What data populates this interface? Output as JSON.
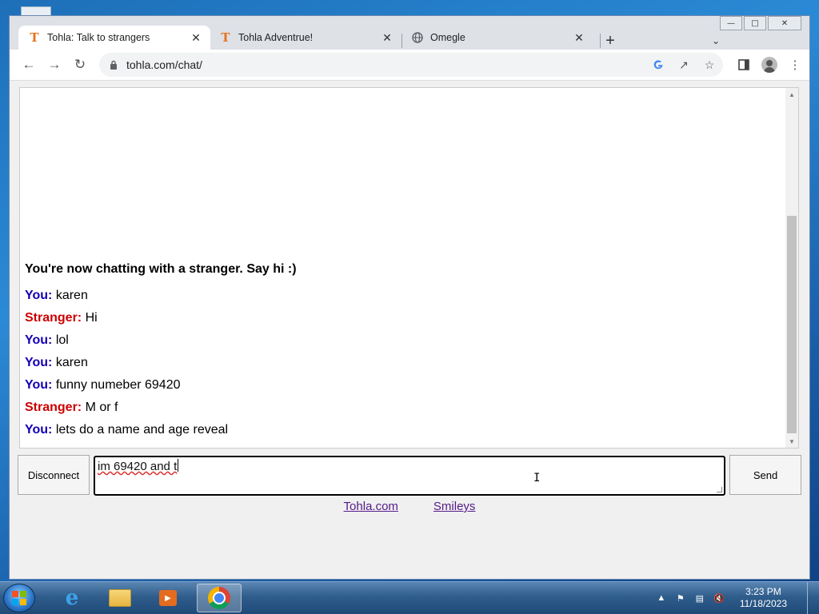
{
  "browser": {
    "tabs": [
      {
        "title": "Tohla: Talk to strangers",
        "favicon": "T",
        "active": true
      },
      {
        "title": "Tohla Adventrue!",
        "favicon": "T",
        "active": false
      },
      {
        "title": "Omegle",
        "favicon": "globe-icon",
        "active": false
      }
    ],
    "url": "tohla.com/chat/"
  },
  "chat": {
    "system_message": "You're now chatting with a stranger. Say hi :)",
    "messages": [
      {
        "sender": "You:",
        "text": "karen"
      },
      {
        "sender": "Stranger:",
        "text": "Hi"
      },
      {
        "sender": "You:",
        "text": "lol"
      },
      {
        "sender": "You:",
        "text": "karen"
      },
      {
        "sender": "You:",
        "text": "funny numeber 69420"
      },
      {
        "sender": "Stranger:",
        "text": "M or f"
      },
      {
        "sender": "You:",
        "text": "lets do a name and age reveal"
      }
    ],
    "disconnect_label": "Disconnect",
    "input_value": "im 69420 and t",
    "send_label": "Send",
    "footer_links": [
      "Tohla.com",
      "Smileys"
    ]
  },
  "taskbar": {
    "time": "3:23 PM",
    "date": "11/18/2023"
  },
  "colors": {
    "you": "#1400b4",
    "stranger": "#cc0000",
    "link": "#551a8b"
  }
}
